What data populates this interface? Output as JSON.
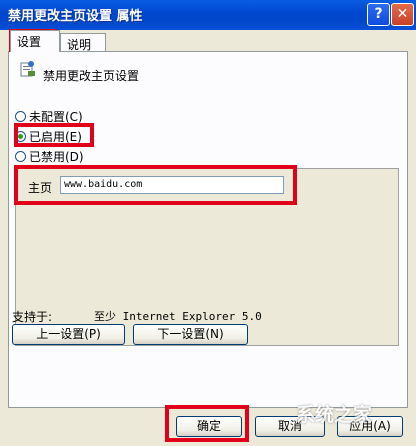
{
  "window": {
    "title": "禁用更改主页设置 属性",
    "help_btn": "?",
    "close_btn": "✕"
  },
  "tabs": [
    {
      "label": "设置",
      "active": true
    },
    {
      "label": "说明",
      "active": false
    }
  ],
  "policy": {
    "title": "禁用更改主页设置",
    "icon": "policy-icon"
  },
  "options": {
    "not_configured": "未配置(C)",
    "enabled": "已启用(E)",
    "disabled": "已禁用(D)",
    "selected": "enabled"
  },
  "homepage": {
    "label": "主页",
    "value": "www.baidu.com"
  },
  "support": {
    "label": "支持于:",
    "value": "至少 Internet Explorer 5.0"
  },
  "nav_buttons": {
    "prev": "上一设置(P)",
    "next": "下一设置(N)"
  },
  "dialog_buttons": {
    "ok": "确定",
    "cancel": "取消",
    "apply": "应用(A)"
  },
  "highlight_color": "#E0001A"
}
